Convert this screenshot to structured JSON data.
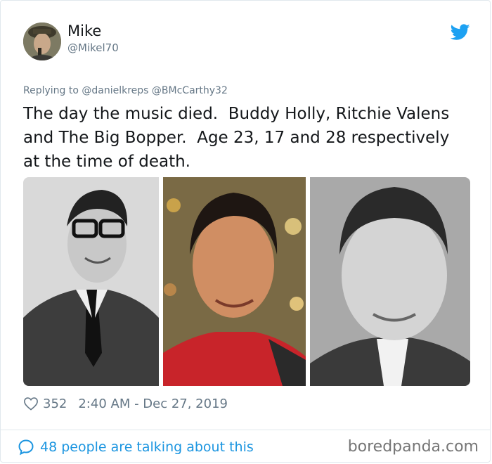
{
  "author": {
    "name": "Mike",
    "handle": "@Mikel70"
  },
  "reply": {
    "text": "Replying to @danielkreps @BMcCarthy32"
  },
  "tweet": {
    "text": "The day the music died.  Buddy Holly, Ritchie Valens\nand The Big Bopper.  Age 23, 17 and 28 respectively\nat the time of death."
  },
  "stats": {
    "likes": "352",
    "timestamp": "2:40 AM - Dec 27, 2019"
  },
  "footer": {
    "talking": "48 people are talking about this",
    "watermark": "boredpanda.com"
  },
  "colors": {
    "accent": "#1b95e0",
    "text": "#14171a",
    "muted": "#657786",
    "border": "#e1e8ed"
  },
  "icons": [
    "avatar",
    "twitter-bird-icon",
    "heart-icon",
    "speech-bubble-icon"
  ]
}
